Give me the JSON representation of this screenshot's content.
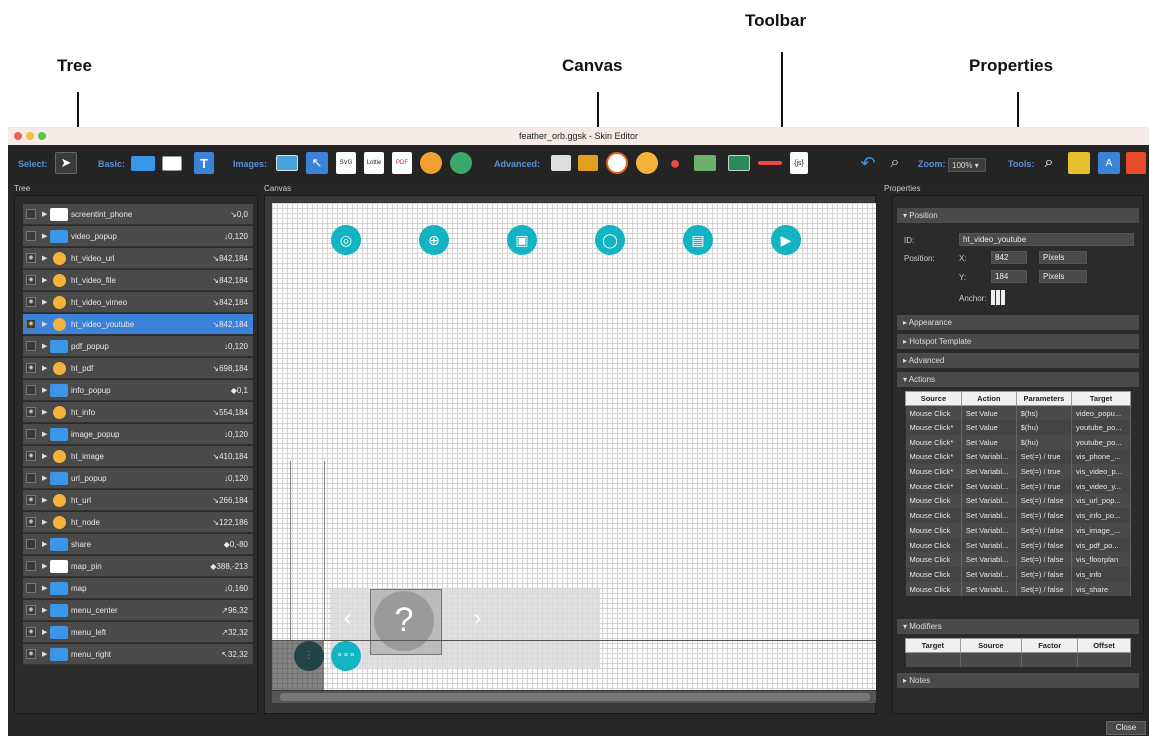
{
  "callouts": {
    "toolbar": "Toolbar",
    "tree": "Tree",
    "canvas": "Canvas",
    "properties": "Properties"
  },
  "window": {
    "title": "feather_orb.ggsk - Skin Editor"
  },
  "toolbar": {
    "select_label": "Select:",
    "basic_label": "Basic:",
    "images_label": "Images:",
    "advanced_label": "Advanced:",
    "zoom_label": "Zoom:",
    "zoom_value": "100%",
    "tools_label": "Tools:"
  },
  "panels": {
    "tree": "Tree",
    "canvas": "Canvas",
    "properties": "Properties"
  },
  "tree": {
    "items": [
      {
        "name": "screentint_phone",
        "coord": "↘0,0",
        "icon": "white",
        "eye": false
      },
      {
        "name": "video_popup",
        "coord": "↓0,120",
        "icon": "folder",
        "eye": false
      },
      {
        "name": "ht_video_url",
        "coord": "↘842,184",
        "icon": "gear",
        "eye": true
      },
      {
        "name": "ht_video_file",
        "coord": "↘842,184",
        "icon": "gear",
        "eye": true
      },
      {
        "name": "ht_video_vimeo",
        "coord": "↘842,184",
        "icon": "gear",
        "eye": true
      },
      {
        "name": "ht_video_youtube",
        "coord": "↘842,184",
        "icon": "gear",
        "eye": true,
        "selected": true
      },
      {
        "name": "pdf_popup",
        "coord": "↓0,120",
        "icon": "folder",
        "eye": false
      },
      {
        "name": "ht_pdf",
        "coord": "↘698,184",
        "icon": "gear",
        "eye": true
      },
      {
        "name": "info_popup",
        "coord": "◆0,1",
        "icon": "folder",
        "eye": false
      },
      {
        "name": "ht_info",
        "coord": "↘554,184",
        "icon": "gear",
        "eye": true
      },
      {
        "name": "image_popup",
        "coord": "↓0,120",
        "icon": "folder",
        "eye": false
      },
      {
        "name": "ht_image",
        "coord": "↘410,184",
        "icon": "gear",
        "eye": true
      },
      {
        "name": "url_popup",
        "coord": "↓0,120",
        "icon": "folder",
        "eye": false
      },
      {
        "name": "ht_url",
        "coord": "↘266,184",
        "icon": "gear",
        "eye": true
      },
      {
        "name": "ht_node",
        "coord": "↘122,186",
        "icon": "gear",
        "eye": true
      },
      {
        "name": "share",
        "coord": "◆0,-80",
        "icon": "folder",
        "eye": false
      },
      {
        "name": "map_pin",
        "coord": "◆388,-213",
        "icon": "white",
        "eye": false
      },
      {
        "name": "map",
        "coord": "↓0,160",
        "icon": "folder",
        "eye": false
      },
      {
        "name": "menu_center",
        "coord": "↗96,32",
        "icon": "folder",
        "eye": true
      },
      {
        "name": "menu_left",
        "coord": "↗32,32",
        "icon": "folder",
        "eye": true
      },
      {
        "name": "menu_right",
        "coord": "↖32,32",
        "icon": "folder",
        "eye": true
      }
    ]
  },
  "properties": {
    "position_section": "Position",
    "id_label": "ID:",
    "id_value": "ht_video_youtube",
    "position_label": "Position:",
    "x_label": "X:",
    "x_value": "842",
    "x_unit": "Pixels",
    "y_label": "Y:",
    "y_value": "184",
    "y_unit": "Pixels",
    "anchor_label": "Anchor:",
    "appearance": "Appearance",
    "hotspot_template": "Hotspot Template",
    "advanced": "Advanced",
    "actions": "Actions",
    "actions_headers": [
      "Source",
      "Action",
      "Parameters",
      "Target"
    ],
    "actions_rows": [
      [
        "Mouse Click",
        "Set Value",
        "$(hs)",
        "video_popu..."
      ],
      [
        "Mouse Click*",
        "Set Value",
        "$(hu)",
        "youtube_po..."
      ],
      [
        "Mouse Click*",
        "Set Value",
        "$(hu)",
        "youtube_po..."
      ],
      [
        "Mouse Click*",
        "Set Variabl...",
        "Set(=) / true",
        "vis_phone_..."
      ],
      [
        "Mouse Click*",
        "Set Variabl...",
        "Set(=) / true",
        "vis_video_p..."
      ],
      [
        "Mouse Click*",
        "Set Variabl...",
        "Set(=) / true",
        "vis_video_y..."
      ],
      [
        "Mouse Click",
        "Set Variabl...",
        "Set(=) / false",
        "vis_url_pop..."
      ],
      [
        "Mouse Click",
        "Set Variabl...",
        "Set(=) / false",
        "vis_info_po..."
      ],
      [
        "Mouse Click",
        "Set Variabl...",
        "Set(=) / false",
        "vis_image_..."
      ],
      [
        "Mouse Click",
        "Set Variabl...",
        "Set(=) / false",
        "vis_pdf_po..."
      ],
      [
        "Mouse Click",
        "Set Variabl...",
        "Set(=) / false",
        "vis_floorplan"
      ],
      [
        "Mouse Click",
        "Set Variabl...",
        "Set(=) / false",
        "vis_info"
      ],
      [
        "Mouse Click",
        "Set Variabl...",
        "Set(=) / false",
        "vis_share"
      ]
    ],
    "modifiers": "Modifiers",
    "modifiers_headers": [
      "Target",
      "Source",
      "Factor",
      "Offset"
    ],
    "notes": "Notes"
  },
  "close_label": "Close"
}
